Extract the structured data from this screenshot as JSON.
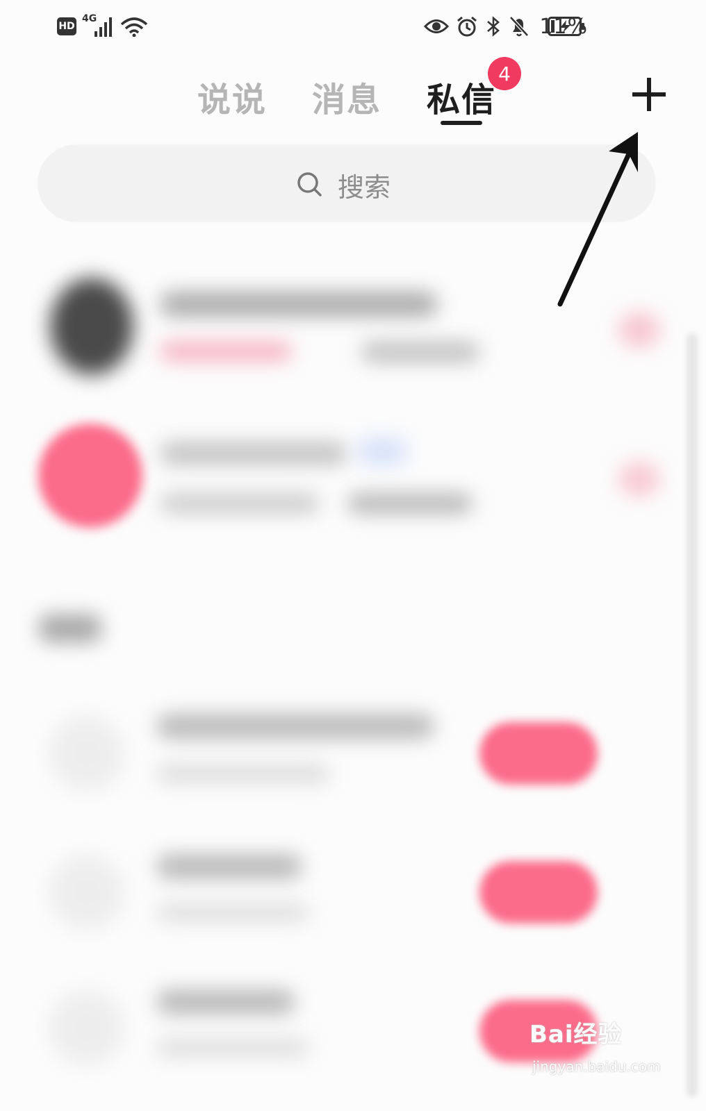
{
  "status_bar": {
    "hd": "HD",
    "network": "4G",
    "battery_percent": "11%",
    "icons": [
      "signal-icon",
      "wifi-icon",
      "eye-icon",
      "alarm-icon",
      "bluetooth-icon",
      "bell-off-icon",
      "battery-charging-icon"
    ]
  },
  "tabs": [
    {
      "label": "说说",
      "active": false
    },
    {
      "label": "消息",
      "active": false
    },
    {
      "label": "私信",
      "active": true,
      "badge": "4"
    }
  ],
  "header": {
    "add_icon": "plus-icon"
  },
  "search": {
    "label": "搜索",
    "icon": "search-icon"
  },
  "colors": {
    "accent": "#f03a5f",
    "pink_button": "#fb6b8a",
    "text_active": "#1e1e1e",
    "text_inactive": "#b5b5b5"
  },
  "watermark": {
    "brand": "Bai经验",
    "site": "jingyan.baidu.com"
  }
}
